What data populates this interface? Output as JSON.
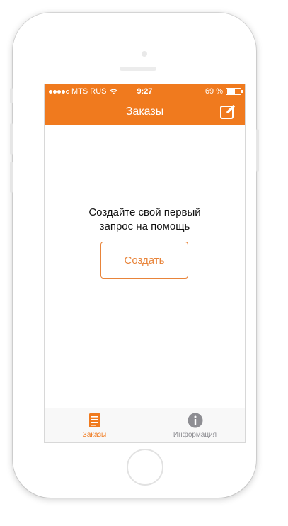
{
  "status_bar": {
    "carrier": "MTS RUS",
    "time": "9:27",
    "battery": "69 %",
    "battery_level": 0.69
  },
  "nav": {
    "title": "Заказы",
    "compose_icon": "compose-icon"
  },
  "empty_state": {
    "line1": "Создайте свой первый",
    "line2": "запрос на помощь",
    "button_label": "Создать"
  },
  "tab_bar": {
    "tabs": [
      {
        "label": "Заказы",
        "icon": "document-icon",
        "active": true
      },
      {
        "label": "Информация",
        "icon": "info-icon",
        "active": false
      }
    ]
  },
  "colors": {
    "accent": "#f07a1e",
    "inactive": "#8e8e93"
  }
}
